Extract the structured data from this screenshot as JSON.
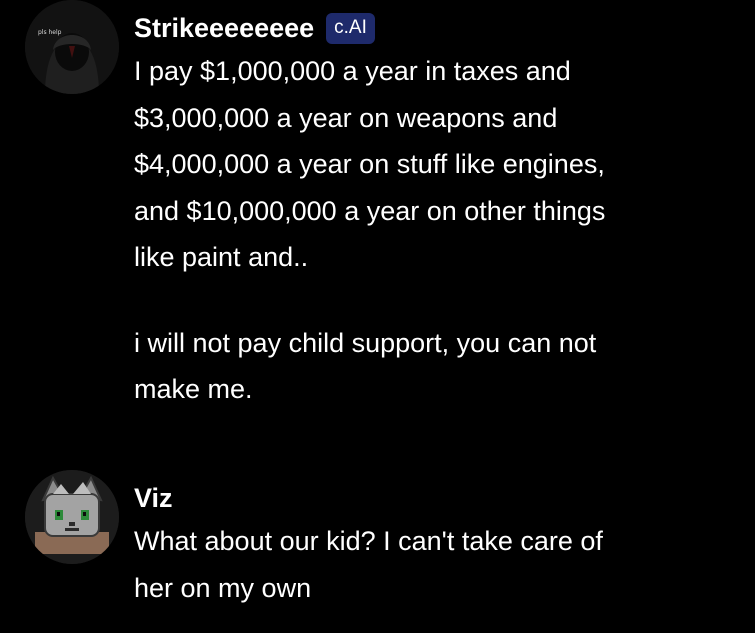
{
  "messages": [
    {
      "author": "Strikeeeeeeee",
      "badge": "c.AI",
      "avatar_caption": "pls help",
      "paragraphs": [
        "I pay $1,000,000 a year in taxes and\n$3,000,000 a year on weapons and\n$4,000,000 a year on stuff like engines,\nand $10,000,000 a year on other things\nlike paint and..",
        "i will not pay child support, you can not\nmake me."
      ]
    },
    {
      "author": "Viz",
      "paragraphs": [
        "What about our kid? I can't take care of\nher on my own"
      ]
    }
  ],
  "colors": {
    "background": "#000000",
    "text": "#ffffff",
    "badge_background": "#1e2a6b"
  },
  "icons": {
    "bot_avatar": "dark-hooded-figure-avatar",
    "user_avatar": "gray-wolf-cat-pixel-avatar"
  }
}
